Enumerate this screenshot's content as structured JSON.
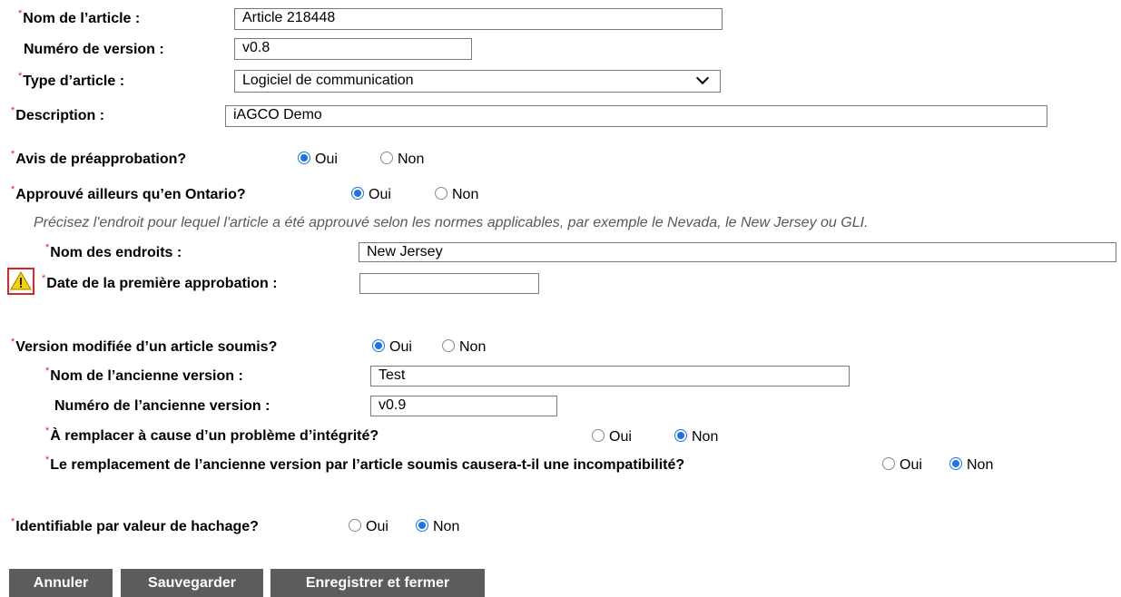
{
  "form": {
    "article_name": {
      "label": "Nom de l’article :",
      "value": "Article 218448"
    },
    "version_number": {
      "label": "Numéro de version :",
      "value": "v0.8"
    },
    "article_type": {
      "label": "Type d’article :",
      "value": "Logiciel de communication"
    },
    "description": {
      "label": "Description :",
      "value": "iAGCO Demo"
    },
    "preapproval": {
      "label": "Avis de préapprobation?",
      "yes": "Oui",
      "no": "Non",
      "selected": "Oui"
    },
    "approved_elsewhere": {
      "label": "Approuvé ailleurs qu’en Ontario?",
      "yes": "Oui",
      "no": "Non",
      "selected": "Oui",
      "hint": "Précisez l'endroit pour lequel l'article a été approuvé selon les normes applicables, par exemple le Nevada, le New Jersey ou GLI.",
      "places": {
        "label": "Nom des endroits :",
        "value": "New Jersey"
      },
      "first_date": {
        "label": "Date de la première approbation :",
        "value": ""
      }
    },
    "modified_version": {
      "label": "Version modifiée d’un article soumis?",
      "yes": "Oui",
      "no": "Non",
      "selected": "Oui",
      "old_name": {
        "label": "Nom de l’ancienne version :",
        "value": "Test"
      },
      "old_number": {
        "label": "Numéro de l’ancienne version :",
        "value": "v0.9"
      },
      "integrity": {
        "label": "À remplacer à cause d’un problème d’intégrité?",
        "yes": "Oui",
        "no": "Non",
        "selected": "Non"
      },
      "incompat": {
        "label": "Le remplacement de l’ancienne version par l’article soumis causera-t-il une incompatibilité?",
        "yes": "Oui",
        "no": "Non",
        "selected": "Non"
      }
    },
    "hash": {
      "label": "Identifiable par valeur de hachage?",
      "yes": "Oui",
      "no": "Non",
      "selected": "Non"
    },
    "required_marker": "*",
    "warning_icon": "warning-triangle-icon"
  },
  "buttons": {
    "cancel": "Annuler",
    "save": "Sauvegarder",
    "save_close": "Enregistrer et fermer"
  },
  "colors": {
    "required": "#d9262b",
    "radio_selected": "#1a73e8",
    "button_bg": "#5c5c5c"
  }
}
